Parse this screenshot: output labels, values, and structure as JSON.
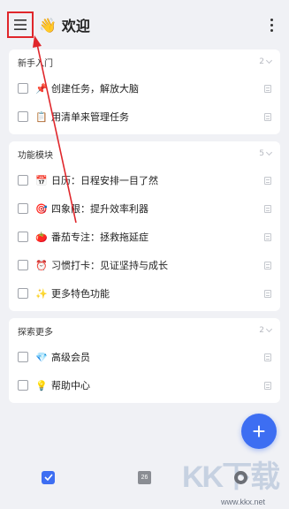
{
  "header": {
    "title": "欢迎",
    "title_emoji": "👋"
  },
  "sections": [
    {
      "title": "新手入门",
      "count": "2",
      "tasks": [
        {
          "emoji": "📌",
          "label": "创建任务，解放大脑"
        },
        {
          "emoji": "📋",
          "label": "用清单来管理任务"
        }
      ]
    },
    {
      "title": "功能模块",
      "count": "5",
      "tasks": [
        {
          "emoji": "📅",
          "label": "日历：日程安排一目了然"
        },
        {
          "emoji": "🎯",
          "label": "四象限：提升效率利器"
        },
        {
          "emoji": "🍅",
          "label": "番茄专注：拯救拖延症"
        },
        {
          "emoji": "⏰",
          "label": "习惯打卡：见证坚持与成长"
        },
        {
          "emoji": "✨",
          "label": "更多特色功能"
        }
      ]
    },
    {
      "title": "探索更多",
      "count": "2",
      "tasks": [
        {
          "emoji": "💎",
          "label": "高级会员"
        },
        {
          "emoji": "💡",
          "label": "帮助中心"
        }
      ]
    }
  ],
  "fab": {
    "symbol": "+"
  },
  "tabbar": {
    "calendar_day": "26"
  },
  "watermark": {
    "text": "KK下载",
    "url": "www.kkx.net"
  },
  "colors": {
    "accent": "#3d6ef2",
    "highlight": "#e0262b",
    "background": "#f0f1f5"
  },
  "icons": [
    "menu-icon",
    "more-vertical-icon",
    "checkbox-icon",
    "note-icon",
    "plus-icon",
    "task-tab-icon",
    "calendar-tab-icon",
    "focus-tab-icon"
  ]
}
